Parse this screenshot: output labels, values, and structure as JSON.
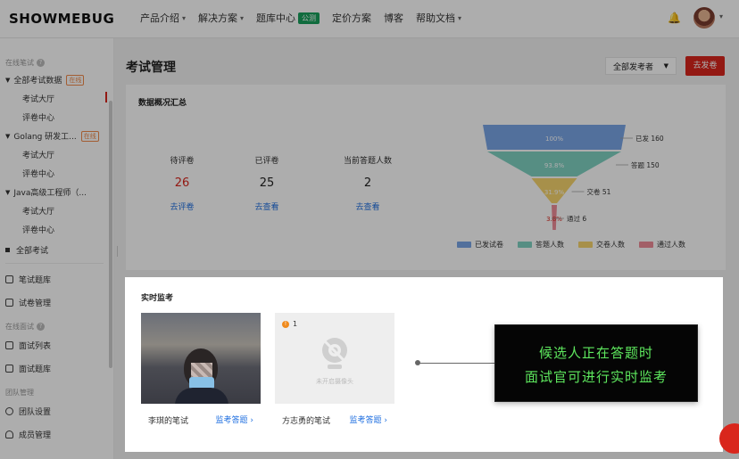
{
  "topbar": {
    "logo": "SHOWMEBUG",
    "nav": [
      {
        "label": "产品介绍",
        "has_dropdown": true
      },
      {
        "label": "解决方案",
        "has_dropdown": true
      },
      {
        "label": "题库中心",
        "badge": "公测"
      },
      {
        "label": "定价方案"
      },
      {
        "label": "博客"
      },
      {
        "label": "帮助文档",
        "has_dropdown": true
      }
    ],
    "chevron": "▾",
    "bell_icon": "bell-icon",
    "bell_glyph": "🔔"
  },
  "sidebar": {
    "section_online_exam": "在线笔试",
    "exam_groups": [
      {
        "label": "全部考试数据",
        "tag": "在线",
        "children": [
          "考试大厅",
          "评卷中心"
        ]
      },
      {
        "label": "Golang 研发工...",
        "tag": "在线",
        "children": [
          "考试大厅",
          "评卷中心"
        ]
      },
      {
        "label": "Java高级工程师（...",
        "children": [
          "考试大厅",
          "评卷中心"
        ]
      }
    ],
    "all_exams": "全部考试",
    "exam_tools": [
      "笔试题库",
      "试卷管理"
    ],
    "section_online_interview": "在线面试",
    "interview_tools": [
      "面试列表",
      "面试题库"
    ],
    "section_team": "团队管理",
    "team_tools": [
      "团队设置",
      "成员管理"
    ]
  },
  "header": {
    "title": "考试管理",
    "filter_value": "全部发考者",
    "primary_button": "去发卷"
  },
  "summary": {
    "title": "数据概况汇总",
    "stats": [
      {
        "label": "待评卷",
        "value": "26",
        "link": "去评卷"
      },
      {
        "label": "已评卷",
        "value": "25",
        "link": "去查看"
      },
      {
        "label": "当前答题人数",
        "value": "2",
        "link": "去查看"
      }
    ]
  },
  "chart_data": {
    "type": "funnel",
    "stages": [
      {
        "name": "已发试卷",
        "value": 160,
        "percent_label": "100%",
        "color": "#7aa6e6"
      },
      {
        "name": "答题人数",
        "value": 150,
        "percent_label": "93.8%",
        "color": "#7fd1c2"
      },
      {
        "name": "交卷人数",
        "value": 51,
        "percent_label": "31.9%",
        "color": "#f7d56e"
      },
      {
        "name": "通过人数",
        "value": 6,
        "percent_label": "3.8%",
        "color": "#ef8d98"
      }
    ],
    "outside_labels": [
      "已发 160",
      "答题 150",
      "交卷 51",
      "通过 6"
    ],
    "legend_position": "bottom"
  },
  "monitor": {
    "title": "实时监考",
    "candidates": [
      {
        "name": "李琪的笔试",
        "link": "监考答题 ›",
        "camera": true
      },
      {
        "name": "方志勇的笔试",
        "link": "监考答题 ›",
        "camera": false,
        "count": "1",
        "camera_text": "未开启摄像头"
      }
    ]
  },
  "callout": {
    "line1": "候选人正在答题时",
    "line2": "面试官可进行实时监考"
  },
  "colors": {
    "brand_red": "#d9261c",
    "link_blue": "#1f6fe0",
    "callout_green": "#5ee85e"
  }
}
